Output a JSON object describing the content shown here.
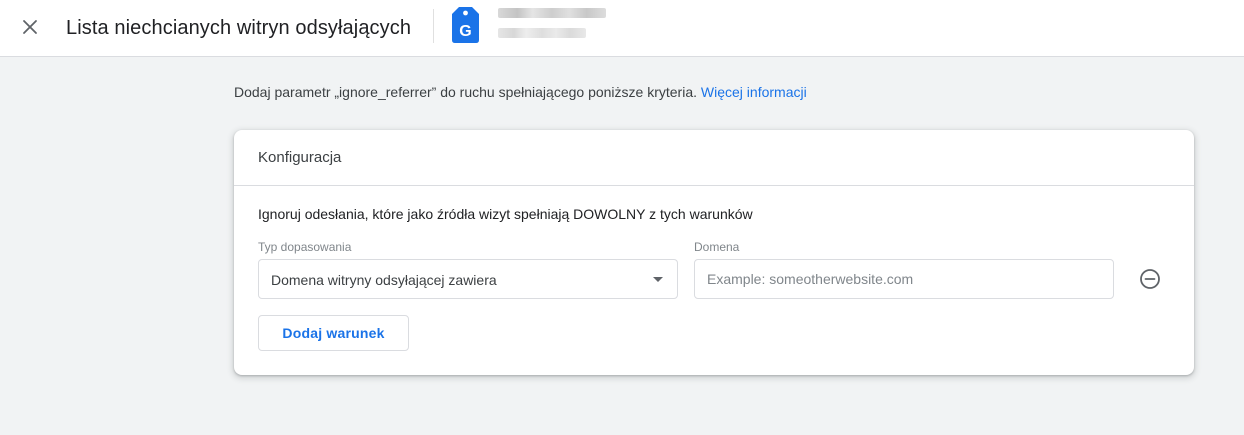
{
  "header": {
    "title": "Lista niechcianych witryn odsyłających",
    "close_icon": "close-icon",
    "product_icon": "google-tag-icon",
    "product_icon_color": "#1a73e8"
  },
  "description": {
    "text": "Dodaj parametr „ignore_referrer” do ruchu spełniającego poniższe kryteria. ",
    "link_label": "Więcej informacji",
    "link_color": "#1a73e8"
  },
  "config_card": {
    "title": "Konfiguracja",
    "rule_heading": "Ignoruj odesłania, które jako źródła wizyt spełniają DOWOLNY z tych warunków",
    "match_type": {
      "label": "Typ dopasowania",
      "value": "Domena witryny odsyłającej zawiera"
    },
    "domain": {
      "label": "Domena",
      "value": "",
      "placeholder": "Example: someotherwebsite.com"
    },
    "remove_icon": "remove-circle-icon",
    "add_condition_label": "Dodaj warunek"
  },
  "colors": {
    "background": "#f1f3f4",
    "accent": "#1a73e8"
  }
}
